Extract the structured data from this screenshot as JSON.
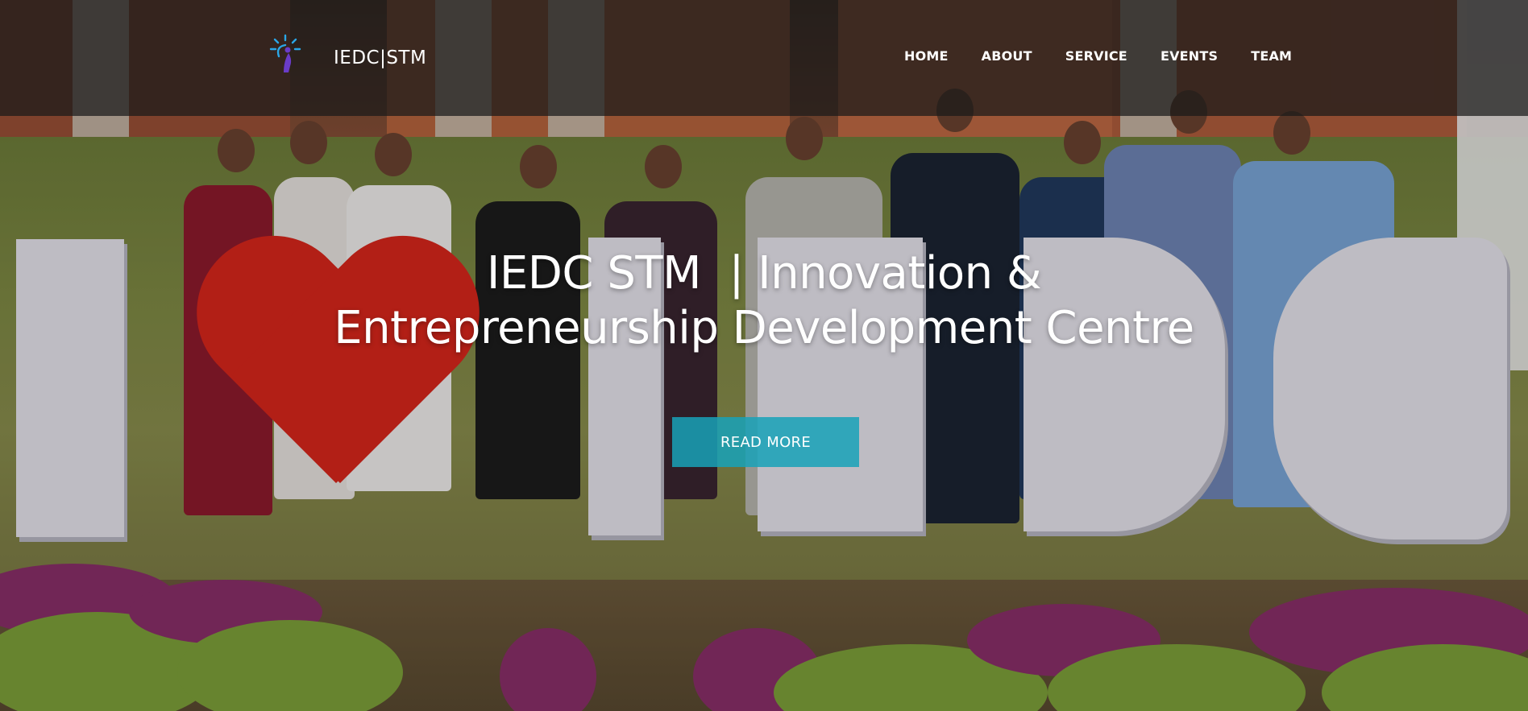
{
  "brand": {
    "logo_icon": "bulb-person-icon",
    "name": "IEDC|STM"
  },
  "nav": {
    "items": [
      {
        "label": "HOME"
      },
      {
        "label": "ABOUT"
      },
      {
        "label": "SERVICE"
      },
      {
        "label": "EVENTS"
      },
      {
        "label": "TEAM"
      }
    ]
  },
  "hero": {
    "title_line1": "IEDC STM  | Innovation &",
    "title_line2": "Entrepreneurship Development Centre",
    "cta_label": "READ MORE",
    "background_description_icon": "group-photo-i-love-iedc-image"
  },
  "colors": {
    "navbar_bg": "#191919",
    "cta_bg": "#17a2b8",
    "text": "#ffffff",
    "logo_blue": "#2aa7e8",
    "logo_purple": "#6a3cc8"
  }
}
